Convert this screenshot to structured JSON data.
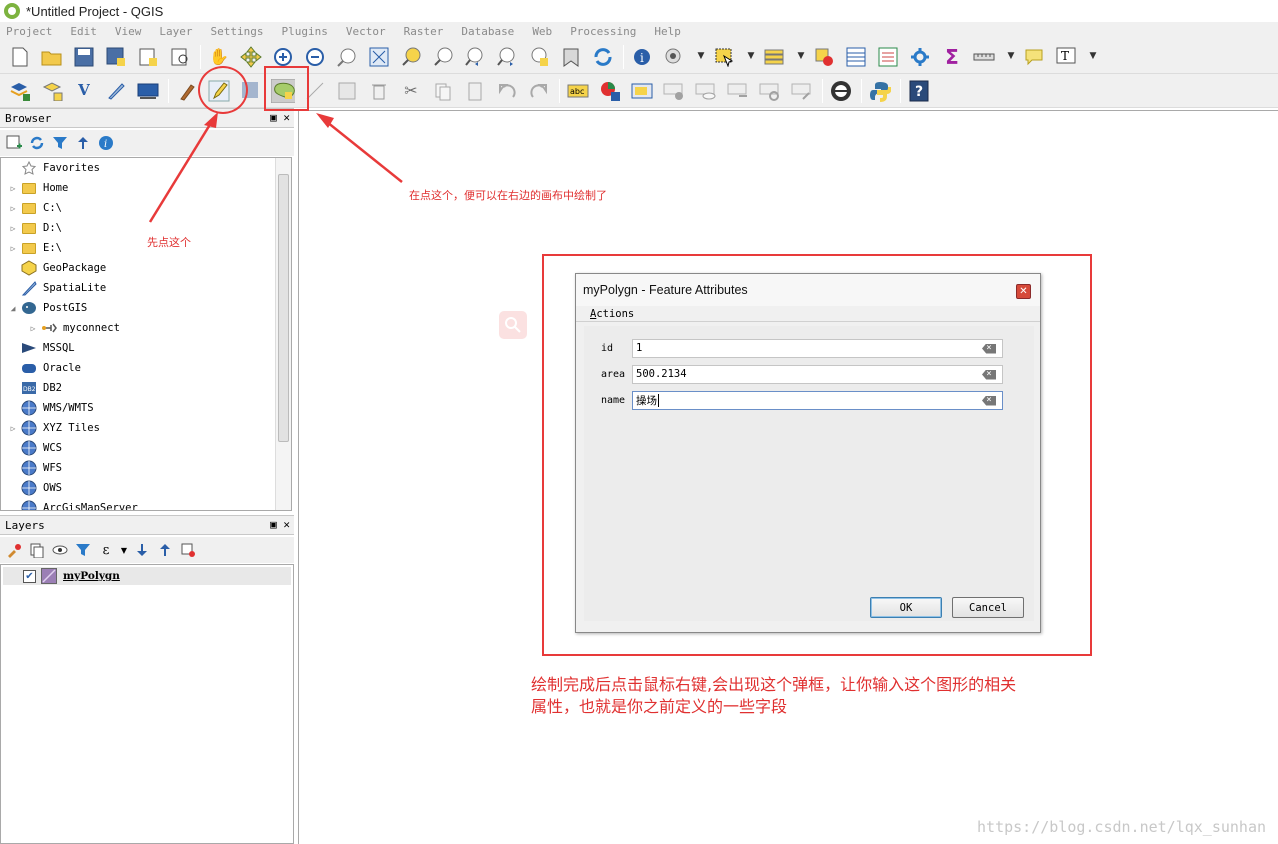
{
  "window": {
    "title": "*Untitled Project - QGIS"
  },
  "menu": [
    "Project",
    "Edit",
    "View",
    "Layer",
    "Settings",
    "Plugins",
    "Vector",
    "Raster",
    "Database",
    "Web",
    "Processing",
    "Help"
  ],
  "browser": {
    "title": "Browser",
    "items": [
      {
        "label": "Favorites",
        "icon": "star-icon",
        "expandable": false
      },
      {
        "label": "Home",
        "icon": "folder-icon",
        "expandable": true
      },
      {
        "label": "C:\\",
        "icon": "folder-icon",
        "expandable": true
      },
      {
        "label": "D:\\",
        "icon": "folder-icon",
        "expandable": true
      },
      {
        "label": "E:\\",
        "icon": "folder-icon",
        "expandable": true
      },
      {
        "label": "GeoPackage",
        "icon": "geopackage-icon",
        "expandable": false
      },
      {
        "label": "SpatiaLite",
        "icon": "feather-icon",
        "expandable": false
      },
      {
        "label": "PostGIS",
        "icon": "elephant-icon",
        "expandable": true,
        "expanded": true
      },
      {
        "label": "myconnect",
        "icon": "connection-icon",
        "expandable": true,
        "indent": true
      },
      {
        "label": "MSSQL",
        "icon": "mssql-icon",
        "expandable": false
      },
      {
        "label": "Oracle",
        "icon": "oracle-icon",
        "expandable": false
      },
      {
        "label": "DB2",
        "icon": "db2-icon",
        "expandable": false
      },
      {
        "label": "WMS/WMTS",
        "icon": "globe-icon",
        "expandable": false
      },
      {
        "label": "XYZ Tiles",
        "icon": "globe-icon",
        "expandable": true
      },
      {
        "label": "WCS",
        "icon": "globe-icon",
        "expandable": false
      },
      {
        "label": "WFS",
        "icon": "globe-icon",
        "expandable": false
      },
      {
        "label": "OWS",
        "icon": "globe-icon",
        "expandable": false
      },
      {
        "label": "ArcGisMapServer",
        "icon": "globe-icon",
        "expandable": false
      }
    ]
  },
  "layers": {
    "title": "Layers",
    "items": [
      {
        "label": "myPolygn",
        "checked": true
      }
    ]
  },
  "dialog": {
    "title": "myPolygn - Feature Attributes",
    "menu_label": "Actions",
    "fields": [
      {
        "label": "id",
        "value": "1"
      },
      {
        "label": "area",
        "value": "500.2134"
      },
      {
        "label": "name",
        "value": "操场"
      }
    ],
    "ok_label": "OK",
    "cancel_label": "Cancel"
  },
  "annotations": {
    "first": "先点这个",
    "second": "在点这个，便可以在右边的画布中绘制了",
    "third_line1": "绘制完成后点击鼠标右键,会出现这个弹框，让你输入这个图形的相关",
    "third_line2": "属性，也就是你之前定义的一些字段",
    "color": "#e03030"
  },
  "watermark": "https://blog.csdn.net/lqx_sunhan"
}
